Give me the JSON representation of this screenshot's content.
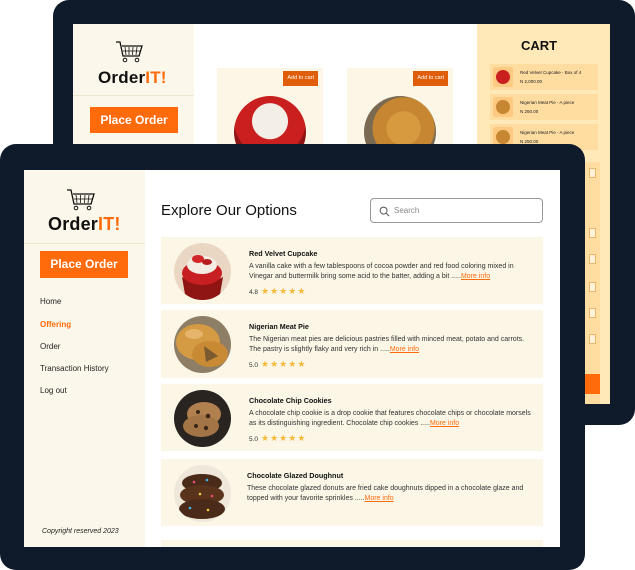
{
  "brand": {
    "name_part1": "Order",
    "name_part2": "IT!"
  },
  "back_screen": {
    "place_order_label": "Place Order",
    "add_to_cart_label": "Add to cart",
    "cart_title": "CART",
    "cart_items": [
      {
        "name": "Red Velvet Cupcake - Box of 4",
        "price": "N 2,000.00"
      },
      {
        "name": "Nigerian Meat Pie - A piece",
        "price": "N 250.00"
      },
      {
        "name": "Nigerian Meat Pie - A piece",
        "price": "N 250.00"
      }
    ]
  },
  "sidebar": {
    "place_order_label": "Place Order",
    "items": [
      {
        "label": "Home",
        "active": false
      },
      {
        "label": "Offering",
        "active": true
      },
      {
        "label": "Order",
        "active": false
      },
      {
        "label": "Transaction History",
        "active": false
      },
      {
        "label": "Log out",
        "active": false
      }
    ],
    "copyright": "Copyright reserved 2023"
  },
  "main": {
    "title": "Explore Our Options",
    "search_placeholder": "Search"
  },
  "products": [
    {
      "name": "Red Velvet Cupcake",
      "description": "A vanilla cake with a few tablespoons of cocoa powder and red food coloring mixed in Vinegar and buttermilk bring some acid to the batter, adding a bit .....",
      "more": "More info",
      "rating": "4.8",
      "stars": "★★★★★"
    },
    {
      "name": "Nigerian Meat Pie",
      "description": "The Nigerian meat pies are delicious pastries filled with minced meat, potato and carrots. The pastry is slightly flaky and very rich in .....",
      "more": "More info",
      "rating": "5.0",
      "stars": "★★★★★"
    },
    {
      "name": "Chocolate Chip Cookies",
      "description": "A chocolate chip cookie is a drop cookie that features chocolate chips or chocolate morsels as its distinguishing ingredient. Chocolate chip cookies .....",
      "more": "More info",
      "rating": "5.0",
      "stars": "★★★★★"
    },
    {
      "name": "Chocolate Glazed Doughnut",
      "description": "These chocolate glazed donuts are fried cake doughnuts dipped in a chocolate glaze and topped with your favorite sprinkles .....",
      "more": "More info",
      "rating": "",
      "stars": ""
    }
  ],
  "colors": {
    "accent": "#ff6a0b",
    "sidebar_bg": "#fbf7ea",
    "card_bg": "#fbf6e6",
    "frame": "#0f1b2b",
    "cart_bg": "#ffe9b8",
    "star": "#f6b93b"
  }
}
